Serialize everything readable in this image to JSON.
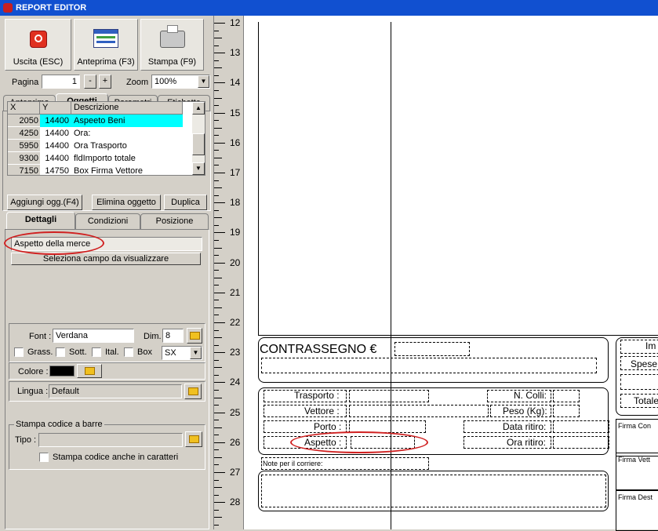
{
  "window": {
    "title": "REPORT EDITOR"
  },
  "toolbar": {
    "exit_label": "Uscita (ESC)",
    "preview_label": "Anteprima (F3)",
    "print_label": "Stampa (F9)"
  },
  "paging": {
    "page_label": "Pagina",
    "page_value": "1",
    "minus": "-",
    "plus": "+",
    "zoom_label": "Zoom",
    "zoom_value": "100%"
  },
  "tabs": [
    "Anteprima",
    "Oggetti",
    "Parametri",
    "Etichette"
  ],
  "grid": {
    "headers": [
      "X",
      "Y",
      "Descrizione"
    ],
    "rows": [
      {
        "x": "2050",
        "y": "14400",
        "desc": "Aspeeto Beni"
      },
      {
        "x": "4250",
        "y": "14400",
        "desc": "Ora:"
      },
      {
        "x": "5950",
        "y": "14400",
        "desc": "Ora Trasporto"
      },
      {
        "x": "9300",
        "y": "14400",
        "desc": "fldImporto totale"
      },
      {
        "x": "7150",
        "y": "14750",
        "desc": "Box Firma Vettore"
      }
    ]
  },
  "object_buttons": {
    "add": "Aggiungi ogg.(F4)",
    "delete": "Elimina oggetto",
    "duplicate": "Duplica"
  },
  "subtabs": [
    "Dettagli",
    "Condizioni",
    "Posizione"
  ],
  "details": {
    "field_value": "Aspetto della merce",
    "select_field_label": "Seleziona campo da visualizzare",
    "font_label": "Font :",
    "font_value": "Verdana",
    "size_label": "Dim.",
    "size_value": "8",
    "bold": "Grass.",
    "underline": "Sott.",
    "italic": "Ital.",
    "box": "Box",
    "align_value": "SX",
    "color_label": "Colore :",
    "color_value": "#000000",
    "language_label": "Lingua :",
    "language_value": "Default",
    "barcode_group": "Stampa codice a barre",
    "type_label": "Tipo :",
    "barcode_chars": "Stampa codice anche in caratteri"
  },
  "ruler": [
    "12",
    "13",
    "14",
    "15",
    "16",
    "17",
    "18",
    "19",
    "20",
    "21",
    "22",
    "23",
    "24",
    "25",
    "26",
    "27",
    "28"
  ],
  "report": {
    "contrassegno": "CONTRASSEGNO €",
    "trasporto": "Trasporto :",
    "vettore": "Vettore :",
    "porto": "Porto :",
    "aspetto": "Aspetto :",
    "colli": "N. Colli:",
    "peso": "Peso (Kg):",
    "data_ritiro": "Data ritiro:",
    "ora_ritiro": "Ora ritiro:",
    "note": "Note  per il corriere:",
    "im": "Im",
    "spese": "Spese",
    "totale": "Totale",
    "firma_con": "Firma Con",
    "firma_vet": "Firma Vett",
    "firma_des": "Firma Dest"
  },
  "colors": {
    "highlight": "#00ffff",
    "annotation": "#d02020",
    "titlebar": "#1150d0"
  }
}
